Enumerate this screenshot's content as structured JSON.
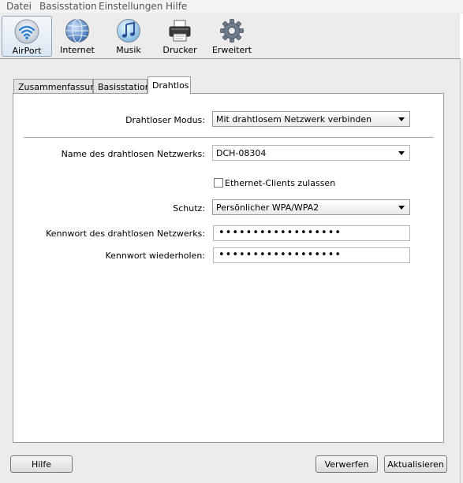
{
  "menubar": {
    "items": [
      "Datei",
      "Basisstation",
      "Einstellungen",
      "Hilfe"
    ]
  },
  "toolbar": {
    "items": [
      {
        "label": "AirPort",
        "icon": "wifi-icon",
        "selected": true
      },
      {
        "label": "Internet",
        "icon": "globe-icon"
      },
      {
        "label": "Musik",
        "icon": "music-icon"
      },
      {
        "label": "Drucker",
        "icon": "printer-icon"
      },
      {
        "label": "Erweitert",
        "icon": "gear-icon"
      }
    ]
  },
  "tabs": [
    {
      "label": "Zusammenfassung"
    },
    {
      "label": "Basisstation"
    },
    {
      "label": "Drahtlos",
      "active": true
    }
  ],
  "form": {
    "mode_label": "Drahtloser Modus:",
    "mode_value": "Mit drahtlosem Netzwerk verbinden",
    "network_name_label": "Name des drahtlosen Netzwerks:",
    "network_name_value": "DCH-08304",
    "ethernet_clients_label": "Ethernet-Clients zulassen",
    "ethernet_clients_checked": false,
    "security_label": "Schutz:",
    "security_value": "Persönlicher WPA/WPA2",
    "password_label": "Kennwort des drahtlosen Netzwerks:",
    "password_value": "••••••••••••••••••",
    "password_repeat_label": "Kennwort wiederholen:",
    "password_repeat_value": "••••••••••••••••••"
  },
  "buttons": {
    "help": "Hilfe",
    "discard": "Verwerfen",
    "update": "Aktualisieren"
  },
  "colors": {
    "selected_tool_bg": "#dbe6f1",
    "chrome_bg": "#ececec"
  }
}
